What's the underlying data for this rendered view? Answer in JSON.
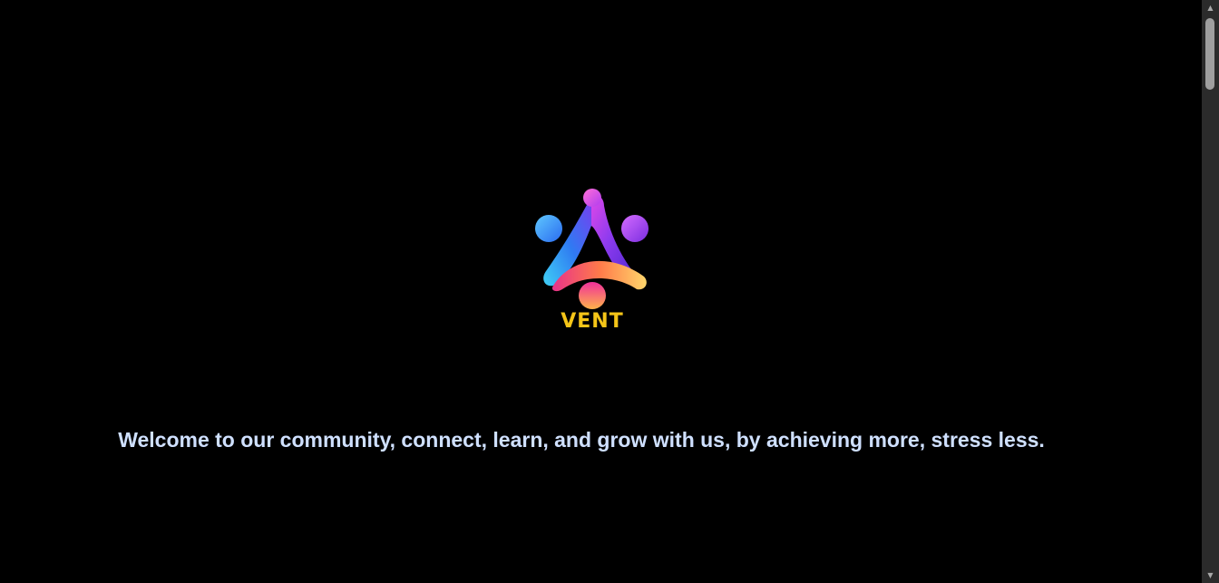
{
  "brand": {
    "name": "VENT",
    "logo_icon": "people-triangle-logo-icon"
  },
  "main": {
    "welcome_text": "Welcome to our community, connect, learn, and grow with us, by achieving more, stress less."
  },
  "colors": {
    "background": "#000000",
    "welcome_text": "#CFE0FF",
    "brand_wordmark": "#F5C518"
  },
  "scrollbar": {
    "up_icon": "scroll-up-arrow-icon",
    "down_icon": "scroll-down-arrow-icon"
  }
}
